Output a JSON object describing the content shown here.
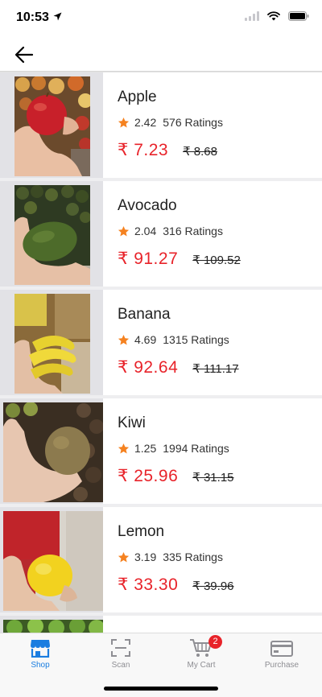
{
  "status_bar": {
    "time": "10:53"
  },
  "products": [
    {
      "name": "Apple",
      "rating": "2.42",
      "ratings_count": "576 Ratings",
      "price": "₹ 7.23",
      "old_price": "₹ 8.68"
    },
    {
      "name": "Avocado",
      "rating": "2.04",
      "ratings_count": "316 Ratings",
      "price": "₹ 91.27",
      "old_price": "₹ 109.52"
    },
    {
      "name": "Banana",
      "rating": "4.69",
      "ratings_count": "1315 Ratings",
      "price": "₹ 92.64",
      "old_price": "₹ 111.17"
    },
    {
      "name": "Kiwi",
      "rating": "1.25",
      "ratings_count": "1994 Ratings",
      "price": "₹ 25.96",
      "old_price": "₹ 31.15"
    },
    {
      "name": "Lemon",
      "rating": "3.19",
      "ratings_count": "335 Ratings",
      "price": "₹ 33.30",
      "old_price": "₹ 39.96"
    }
  ],
  "tabs": [
    {
      "label": "Shop",
      "icon": "store-icon",
      "active": true
    },
    {
      "label": "Scan",
      "icon": "scan-icon"
    },
    {
      "label": "My Cart",
      "icon": "cart-icon",
      "badge": "2"
    },
    {
      "label": "Purchase",
      "icon": "credit-card-icon"
    }
  ],
  "colors": {
    "price": "#e8232a",
    "star": "#f58220",
    "active_tab": "#1a7de0",
    "inactive_tab": "#8e8e93"
  }
}
